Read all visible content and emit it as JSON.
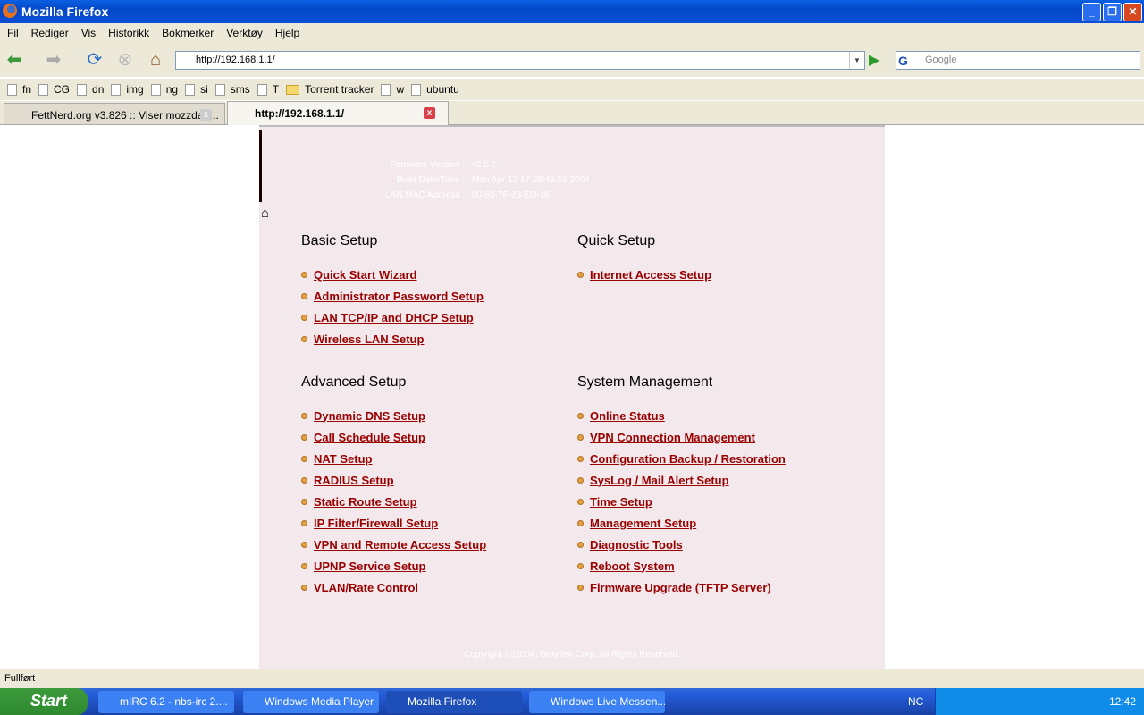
{
  "window": {
    "title": "Mozilla Firefox"
  },
  "menu": [
    "Fil",
    "Rediger",
    "Vis",
    "Historikk",
    "Bokmerker",
    "Verktøy",
    "Hjelp"
  ],
  "nav": {
    "url": "http://192.168.1.1/",
    "search_placeholder": "Google"
  },
  "bookmarks": [
    {
      "label": "fn",
      "icon": "page"
    },
    {
      "label": "CG",
      "icon": "page"
    },
    {
      "label": "dn",
      "icon": "page"
    },
    {
      "label": "img",
      "icon": "page"
    },
    {
      "label": "ng",
      "icon": "page"
    },
    {
      "label": "si",
      "icon": "page"
    },
    {
      "label": "sms",
      "icon": "page"
    },
    {
      "label": "T",
      "icon": "page"
    },
    {
      "label": "Torrent tracker",
      "icon": "folder"
    },
    {
      "label": "w",
      "icon": "page"
    },
    {
      "label": "ubuntu",
      "icon": "page"
    }
  ],
  "tabs": [
    {
      "label": "FettNerd.org v3.826 :: Viser mozzdart..."
    },
    {
      "label": "http://192.168.1.1/"
    }
  ],
  "info": {
    "firmware_label": "Firmware Version :",
    "firmware": "v2.5.2",
    "build_label": "Build Date/Time :",
    "build": "Mon Apr 12 17:28:49.51 2004",
    "mac_label": "LAN MAC Address :",
    "mac": "00-50-7F-23-ED-18"
  },
  "sections": [
    {
      "title": "Basic Setup",
      "links": [
        "Quick Start Wizard",
        "Administrator Password Setup",
        "LAN TCP/IP and DHCP Setup",
        "Wireless LAN Setup"
      ]
    },
    {
      "title": "Quick Setup",
      "links": [
        "Internet Access Setup"
      ]
    },
    {
      "title": "Advanced Setup",
      "links": [
        "Dynamic DNS Setup",
        "Call Schedule Setup",
        "NAT Setup",
        "RADIUS Setup",
        "Static Route Setup",
        "IP Filter/Firewall Setup",
        "VPN and Remote Access Setup",
        "UPNP Service Setup",
        "VLAN/Rate Control"
      ]
    },
    {
      "title": "System Management",
      "links": [
        "Online Status",
        "VPN Connection Management",
        "Configuration Backup / Restoration",
        "SysLog / Mail Alert Setup",
        "Time Setup",
        "Management Setup",
        "Diagnostic Tools",
        "Reboot System",
        "Firmware Upgrade (TFTP Server)"
      ]
    }
  ],
  "copyright": "Copyright (c)2004, DrayTek Corp. All Rights Reserved.",
  "status": "Fullført",
  "taskbar": {
    "start": "Start",
    "items": [
      "mIRC 6.2 - nbs-irc 2....",
      "Windows Media Player",
      "Mozilla Firefox",
      "Windows Live Messen..."
    ],
    "lang": "NC",
    "clock": "12:42"
  },
  "colors": {
    "link": "#990000",
    "panel": "#f3e9ec"
  }
}
